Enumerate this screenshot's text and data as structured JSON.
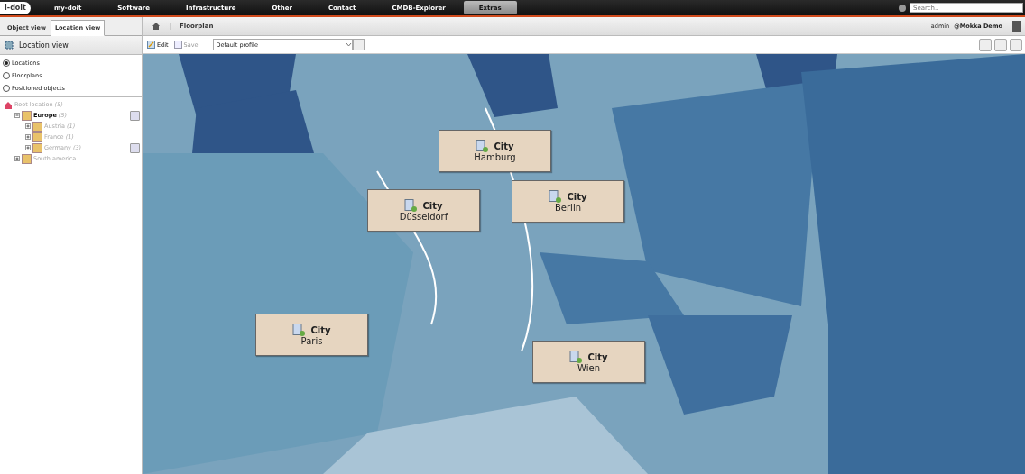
{
  "topnav": {
    "logo": "i-doit",
    "items": [
      {
        "label": "my-doit",
        "selected": false
      },
      {
        "label": "Software",
        "selected": false
      },
      {
        "label": "Infrastructure",
        "selected": false
      },
      {
        "label": "Other",
        "selected": false
      },
      {
        "label": "Contact",
        "selected": false
      },
      {
        "label": "CMDB-Explorer",
        "selected": false
      },
      {
        "label": "Extras",
        "selected": true
      }
    ],
    "search": {
      "placeholder": "Search.."
    }
  },
  "view_tabs": [
    {
      "label": "Object view",
      "selected": false
    },
    {
      "label": "Location view",
      "selected": true
    }
  ],
  "breadcrumb": [
    "Floorplan"
  ],
  "user": {
    "name": "admin",
    "tenant": "@Mokka Demo"
  },
  "sidebar": {
    "title": "Location view",
    "radios": [
      {
        "label": "Locations",
        "selected": true
      },
      {
        "label": "Floorplans",
        "selected": false
      },
      {
        "label": "Positioned objects",
        "selected": false
      }
    ],
    "tree": [
      {
        "label": "Root location",
        "count": "(5)",
        "kind": "root",
        "selected": false,
        "children": [
          {
            "label": "Europe",
            "count": "(5)",
            "kind": "location",
            "selected": true,
            "positioned": true,
            "expanded": true,
            "children": [
              {
                "label": "Austria",
                "count": "(1)",
                "kind": "location",
                "selected": false,
                "positioned": false,
                "expanded": false
              },
              {
                "label": "France",
                "count": "(1)",
                "kind": "location",
                "selected": false,
                "positioned": false,
                "expanded": false
              },
              {
                "label": "Germany",
                "count": "(3)",
                "kind": "location",
                "selected": false,
                "positioned": true,
                "expanded": false
              }
            ]
          },
          {
            "label": "South america",
            "kind": "location",
            "selected": false,
            "positioned": false,
            "expanded": false
          }
        ]
      }
    ]
  },
  "toolbar": {
    "edit": "Edit",
    "save": "Save",
    "profile": "Default profile"
  },
  "floorplan": {
    "objects": [
      {
        "type": "City",
        "name": "Hamburg"
      },
      {
        "type": "City",
        "name": "Düsseldorf"
      },
      {
        "type": "City",
        "name": "Berlin"
      },
      {
        "type": "City",
        "name": "Paris"
      },
      {
        "type": "City",
        "name": "Wien"
      }
    ]
  }
}
